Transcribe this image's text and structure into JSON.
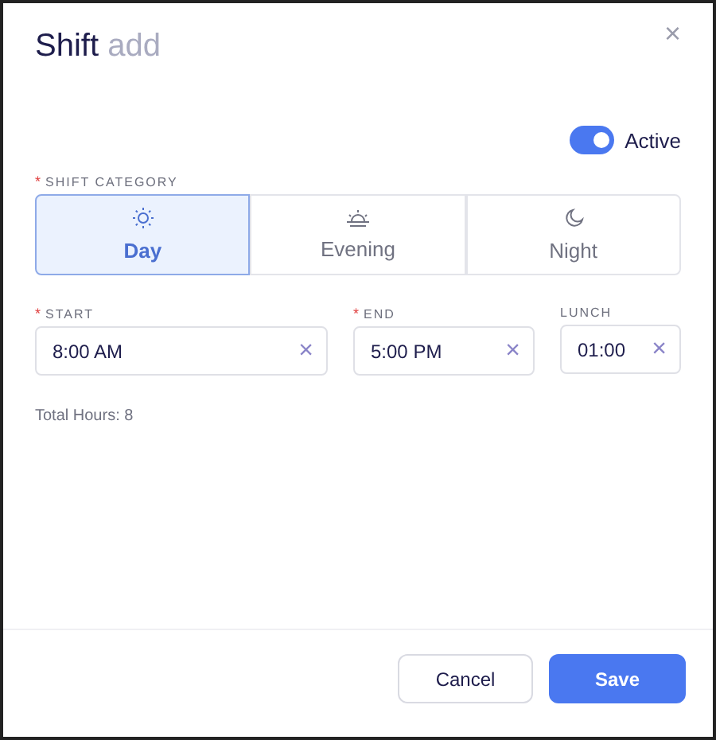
{
  "dialog": {
    "title": "Shift",
    "subtitle": "add",
    "close": "×"
  },
  "active": {
    "label": "Active",
    "on": true
  },
  "shift_category": {
    "label": "SHIFT CATEGORY",
    "required_mark": "*",
    "options": [
      {
        "label": "Day",
        "kind": "sun",
        "selected": true
      },
      {
        "label": "Evening",
        "kind": "sunset",
        "selected": false
      },
      {
        "label": "Night",
        "kind": "moon",
        "selected": false
      }
    ]
  },
  "fields": [
    {
      "label": "START",
      "required_mark": "*",
      "value": "8:00 AM",
      "clear": "×"
    },
    {
      "label": "END",
      "required_mark": "*",
      "value": "5:00 PM",
      "clear": "×"
    },
    {
      "label": "LUNCH",
      "value": "01:00",
      "clear": "×"
    }
  ],
  "total_hours": "Total Hours: 8",
  "buttons": [
    {
      "label": "Cancel",
      "kind": "secondary"
    },
    {
      "label": "Save",
      "kind": "primary"
    }
  ]
}
